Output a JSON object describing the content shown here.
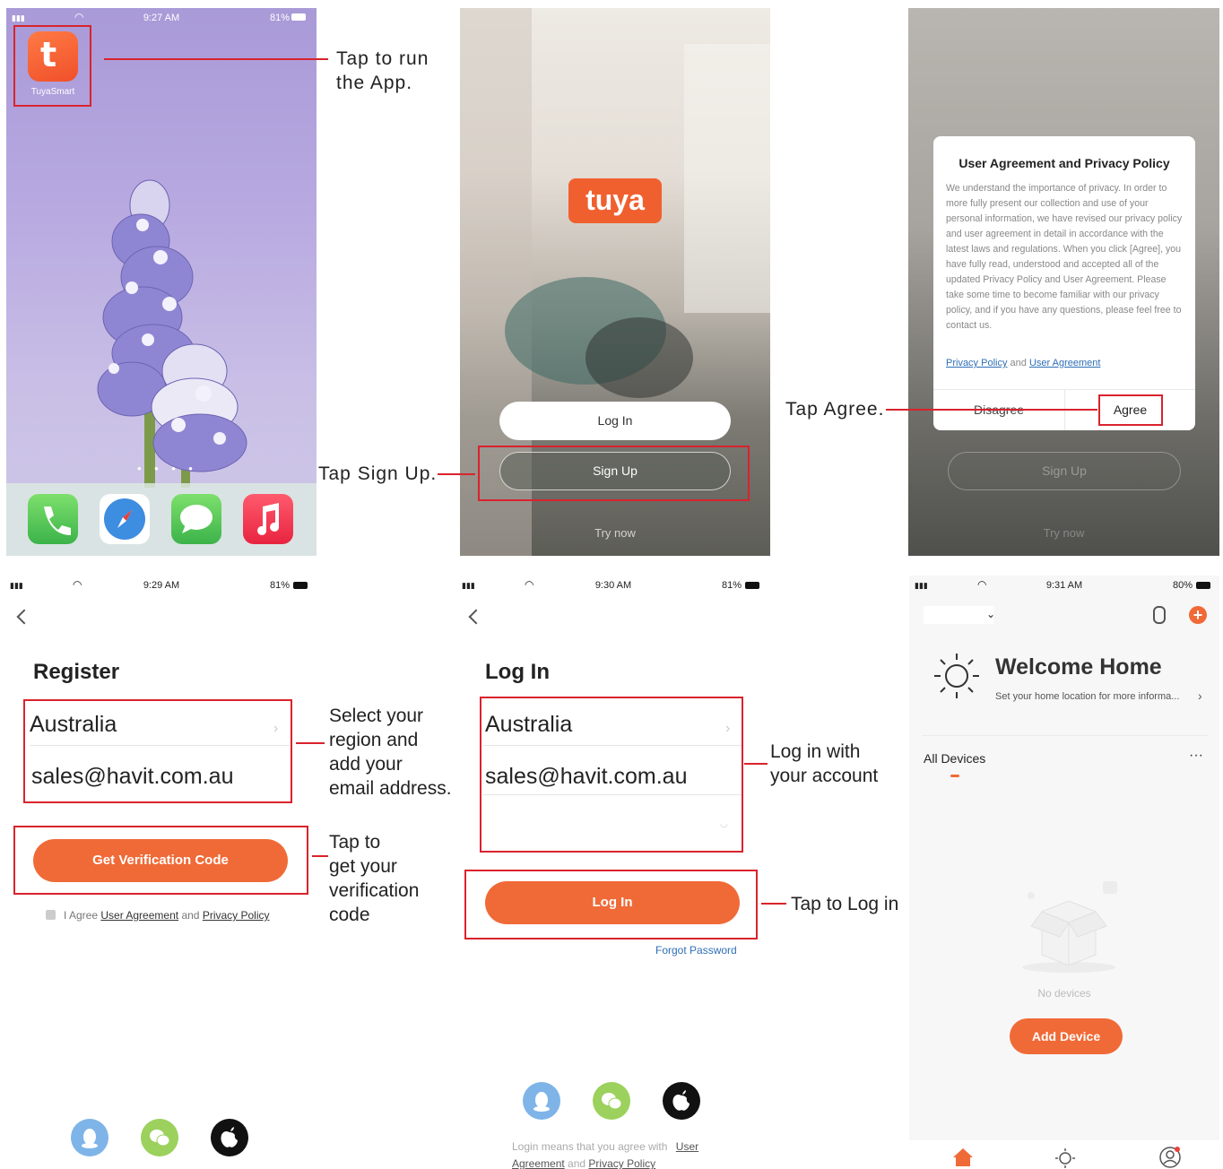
{
  "callouts": {
    "run_app": "Tap to run\nthe App.",
    "sign_up": "Tap Sign Up.",
    "agree": "Tap Agree.",
    "region": "Select your\nregion and\nadd your\nemail address.",
    "verify": "Tap to\nget your\nverification\ncode",
    "login_account": "Log in with\nyour account",
    "tap_login": "Tap to Log in"
  },
  "screen1": {
    "time": "9:27 AM",
    "battery": "81%",
    "app_label": "TuyaSmart",
    "icon": "tuya-app-icon",
    "dock": [
      "phone-icon",
      "safari-icon",
      "messages-icon",
      "music-icon"
    ]
  },
  "screen2": {
    "logo": "tuya",
    "login": "Log In",
    "signup": "Sign Up",
    "try_now": "Try now"
  },
  "screen3": {
    "dialog_title": "User Agreement and Privacy Policy",
    "dialog_body": "We understand the importance of privacy. In order to more fully present our collection and use of your personal information, we have revised our privacy policy and user agreement in detail in accordance with the latest laws and regulations. When you click [Agree], you have fully read, understood and accepted all of the updated Privacy Policy and User Agreement. Please take some time to become familiar with our privacy policy, and if you have any questions, please feel free to contact us.",
    "link_privacy": "Privacy Policy",
    "link_and": "and",
    "link_user": "User Agreement",
    "disagree": "Disagree",
    "agree": "Agree",
    "signup": "Sign Up",
    "try_now": "Try now"
  },
  "screen4": {
    "time": "9:29 AM",
    "battery": "81%",
    "title": "Register",
    "region": "Australia",
    "email": "sales@havit.com.au",
    "button": "Get Verification Code",
    "agree_prefix": "I Agree",
    "agree_user": "User Agreement",
    "agree_and": "and",
    "agree_privacy": "Privacy Policy"
  },
  "screen5": {
    "time": "9:30 AM",
    "battery": "81%",
    "title": "Log In",
    "region": "Australia",
    "email": "sales@havit.com.au",
    "button": "Log In",
    "forgot": "Forgot Password",
    "footer_prefix": "Login means that you agree with",
    "footer_user1": "User",
    "footer_user2": "Agreement",
    "footer_and": "and",
    "footer_privacy": "Privacy Policy"
  },
  "screen6": {
    "time": "9:31 AM",
    "battery": "80%",
    "welcome": "Welcome Home",
    "subtitle": "Set your home location for more informa...",
    "all_devices": "All Devices",
    "more": "···",
    "no_devices": "No devices",
    "add_device": "Add Device"
  },
  "colors": {
    "accent": "#f06a37",
    "annotation": "#d9232d",
    "link": "#2f6fb6"
  }
}
